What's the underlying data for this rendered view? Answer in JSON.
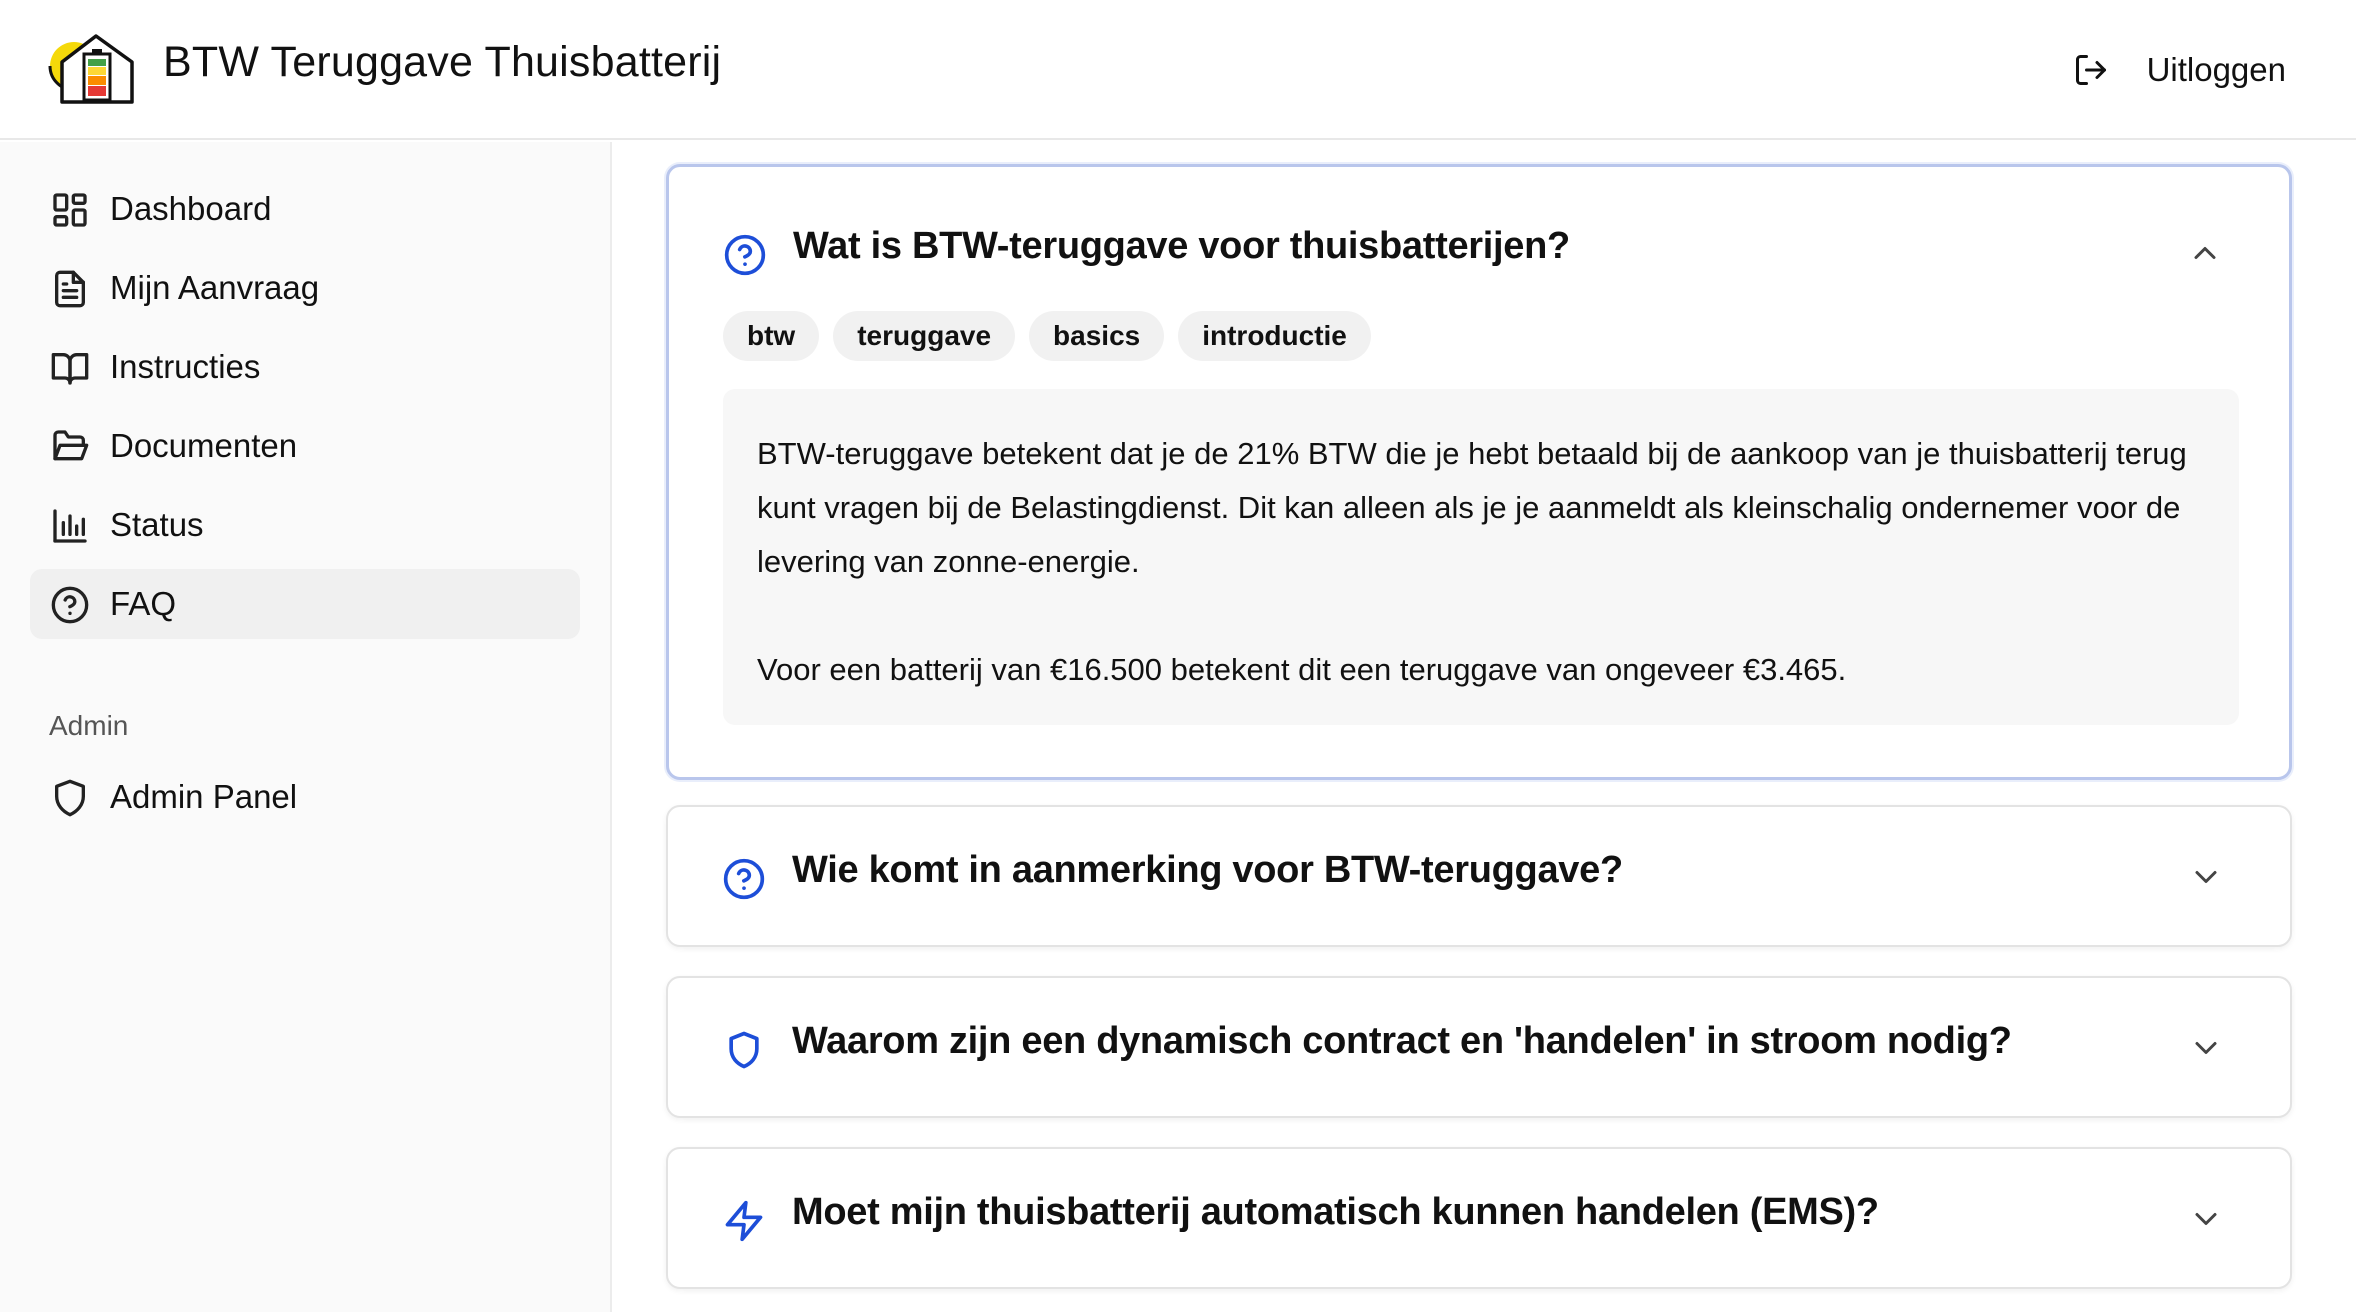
{
  "header": {
    "title": "BTW Teruggave Thuisbatterij",
    "logo_icon": "house-battery-sun-logo",
    "logout_label": "Uitloggen",
    "logout_icon": "logout-icon"
  },
  "sidebar": {
    "items": [
      {
        "label": "Dashboard",
        "icon": "dashboard-icon"
      },
      {
        "label": "Mijn Aanvraag",
        "icon": "document-icon"
      },
      {
        "label": "Instructies",
        "icon": "book-icon"
      },
      {
        "label": "Documenten",
        "icon": "folder-icon"
      },
      {
        "label": "Status",
        "icon": "bar-chart-icon"
      },
      {
        "label": "FAQ",
        "icon": "help-circle-icon",
        "active": true
      }
    ],
    "admin_section_label": "Admin",
    "admin_items": [
      {
        "label": "Admin Panel",
        "icon": "shield-icon"
      }
    ]
  },
  "faq": {
    "items": [
      {
        "question": "Wat is BTW-teruggave voor thuisbatterijen?",
        "icon": "help-circle-icon",
        "expanded": true,
        "tags": [
          "btw",
          "teruggave",
          "basics",
          "introductie"
        ],
        "answer_p1": "BTW-teruggave betekent dat je de 21% BTW die je hebt betaald bij de aankoop van je thuisbatterij terug kunt vragen bij de Belastingdienst. Dit kan alleen als je je aanmeldt als kleinschalig ondernemer voor de levering van zonne-energie.",
        "answer_p2": "Voor een batterij van €16.500 betekent dit een teruggave van ongeveer €3.465."
      },
      {
        "question": "Wie komt in aanmerking voor BTW-teruggave?",
        "icon": "help-circle-icon",
        "expanded": false
      },
      {
        "question": "Waarom zijn een dynamisch contract en 'handelen' in stroom nodig?",
        "icon": "shield-icon",
        "expanded": false
      },
      {
        "question": "Moet mijn thuisbatterij automatisch kunnen handelen (EMS)?",
        "icon": "lightning-icon",
        "expanded": false
      }
    ]
  },
  "colors": {
    "accent": "#1d4ed8",
    "open_border": "#b9c6ec",
    "active_nav_bg": "#f0f0f0",
    "logo_sun": "#f5d90a"
  }
}
